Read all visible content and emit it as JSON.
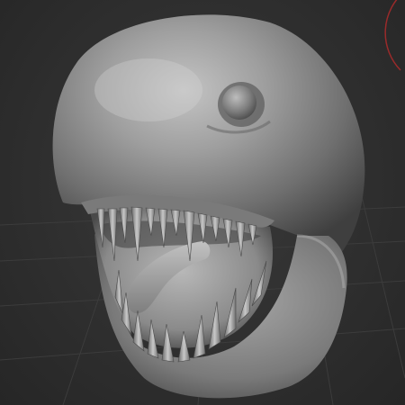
{
  "viewport": {
    "background": "#2f2f2f",
    "grid_color": "#3c3c3c",
    "gizmo_color": "#9a2a2a"
  },
  "model": {
    "name": "creature-head-sculpt",
    "material_color": "#8c8c8c",
    "shadow_color": "#3e3e3e",
    "mouth_color": "#a9a9a9",
    "tooth_color": "#b5b5b5"
  },
  "icons": {
    "rotation_gizmo": "rotation-gizmo-icon"
  }
}
